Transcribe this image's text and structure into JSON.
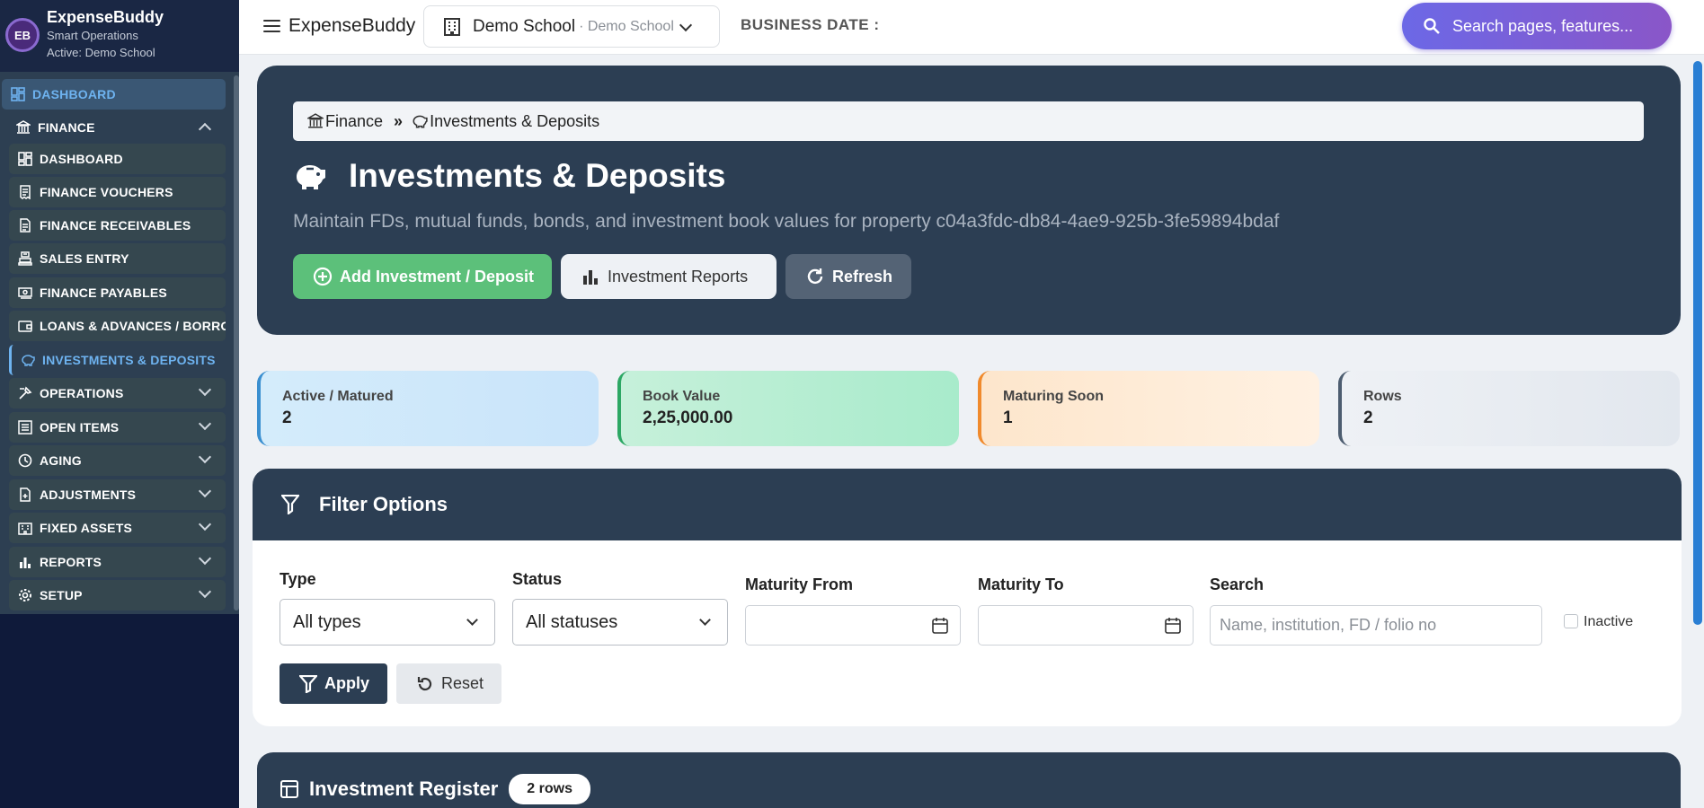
{
  "brand": {
    "name": "ExpenseBuddy",
    "subtitle": "Smart Operations",
    "active": "Active: Demo School",
    "logo_text": "EB"
  },
  "sidebar": {
    "items": [
      {
        "label": "DASHBOARD",
        "icon": "dashboard-icon"
      },
      {
        "label": "FINANCE",
        "icon": "bank-icon"
      },
      {
        "label": "DASHBOARD",
        "icon": "dashboard-icon"
      },
      {
        "label": "FINANCE VOUCHERS",
        "icon": "receipt-icon"
      },
      {
        "label": "FINANCE RECEIVABLES",
        "icon": "document-icon"
      },
      {
        "label": "SALES ENTRY",
        "icon": "register-icon"
      },
      {
        "label": "FINANCE PAYABLES",
        "icon": "cash-icon"
      },
      {
        "label": "LOANS & ADVANCES / BORROWINGS",
        "icon": "wallet-icon"
      },
      {
        "label": "INVESTMENTS & DEPOSITS",
        "icon": "piggy-bank-icon"
      },
      {
        "label": "OPERATIONS",
        "icon": "operations-icon"
      },
      {
        "label": "OPEN ITEMS",
        "icon": "list-icon"
      },
      {
        "label": "AGING",
        "icon": "clock-icon"
      },
      {
        "label": "ADJUSTMENTS",
        "icon": "file-plus-icon"
      },
      {
        "label": "FIXED ASSETS",
        "icon": "building-icon"
      },
      {
        "label": "REPORTS",
        "icon": "bar-chart-icon"
      },
      {
        "label": "SETUP",
        "icon": "gear-icon"
      }
    ]
  },
  "header": {
    "app_title": "ExpenseBuddy",
    "school_name": "Demo School",
    "school_sub": "· Demo School",
    "business_date_label": "BUSINESS DATE :",
    "search_placeholder": "Search pages, features..."
  },
  "hero": {
    "breadcrumb": [
      "Finance",
      "»",
      "Investments & Deposits"
    ],
    "title": "Investments & Deposits",
    "description": "Maintain FDs, mutual funds, bonds, and investment book values for property c04a3fdc-db84-4ae9-925b-3fe59894bdaf",
    "buttons": {
      "add": "Add Investment / Deposit",
      "reports": "Investment Reports",
      "refresh": "Refresh"
    }
  },
  "stats": [
    {
      "label": "Active / Matured",
      "value": "2"
    },
    {
      "label": "Book Value",
      "value": "2,25,000.00"
    },
    {
      "label": "Maturing Soon",
      "value": "1"
    },
    {
      "label": "Rows",
      "value": "2"
    }
  ],
  "filters": {
    "title": "Filter Options",
    "type_label": "Type",
    "type_value": "All types",
    "status_label": "Status",
    "status_value": "All statuses",
    "maturity_from_label": "Maturity From",
    "maturity_to_label": "Maturity To",
    "search_label": "Search",
    "search_placeholder": "Name, institution, FD / folio no",
    "inactive_label": "Inactive",
    "apply": "Apply",
    "reset": "Reset"
  },
  "register": {
    "title": "Investment Register",
    "rows_badge": "2 rows"
  },
  "colors": {
    "primary_dark": "#2c3e53",
    "success": "#5cc07a",
    "accent": "#6c68e6",
    "sidebar": "#2d3f52"
  }
}
